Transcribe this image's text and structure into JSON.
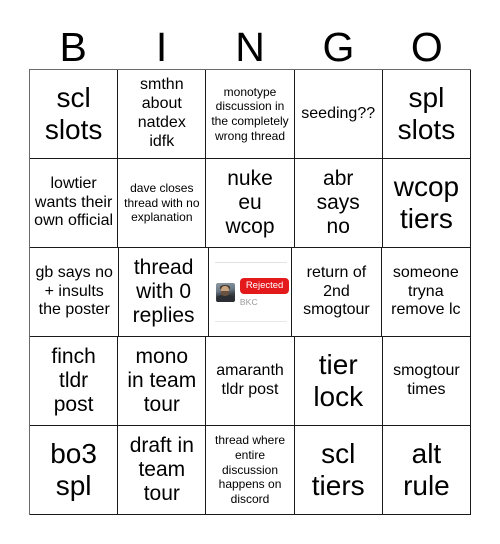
{
  "card": {
    "headers": [
      "B",
      "I",
      "N",
      "G",
      "O"
    ],
    "rows": [
      [
        {
          "text": "scl\nslots",
          "size": "xl"
        },
        {
          "text": "smthn\nabout\nnatdex\nidfk",
          "size": "md"
        },
        {
          "text": "monotype discussion in the completely wrong thread",
          "size": "sm"
        },
        {
          "text": "seeding??",
          "size": "md"
        },
        {
          "text": "spl\nslots",
          "size": "xl"
        }
      ],
      [
        {
          "text": "lowtier wants their own official",
          "size": "md"
        },
        {
          "text": "dave closes thread with no explanation",
          "size": "sm"
        },
        {
          "text": "nuke\neu\nwcop",
          "size": "lg"
        },
        {
          "text": "abr\nsays\nno",
          "size": "lg"
        },
        {
          "text": "wcop\ntiers",
          "size": "xl"
        }
      ],
      [
        {
          "text": "gb says no + insults the poster",
          "size": "md"
        },
        {
          "text": "thread\nwith 0\nreplies",
          "size": "lg"
        },
        {
          "type": "image",
          "text": "",
          "size": "sm"
        },
        {
          "text": "return of 2nd smogtour",
          "size": "md"
        },
        {
          "text": "someone tryna remove lc",
          "size": "md"
        }
      ],
      [
        {
          "text": "finch\ntldr\npost",
          "size": "lg"
        },
        {
          "text": "mono\nin team\ntour",
          "size": "lg"
        },
        {
          "text": "amaranth tldr post",
          "size": "md"
        },
        {
          "text": "tier\nlock",
          "size": "xl"
        },
        {
          "text": "smogtour\ntimes",
          "size": "md"
        }
      ],
      [
        {
          "text": "bo3\nspl",
          "size": "xl"
        },
        {
          "text": "draft in\nteam\ntour",
          "size": "lg"
        },
        {
          "text": "thread where entire discussion happens on discord",
          "size": "sm"
        },
        {
          "text": "scl\ntiers",
          "size": "xl"
        },
        {
          "text": "alt\nrule",
          "size": "xl"
        }
      ]
    ],
    "image_cell": {
      "badge_label": "Rejected",
      "username": "BKC",
      "badge_color": "#e4191c",
      "username_color": "#9a9a9a"
    }
  }
}
